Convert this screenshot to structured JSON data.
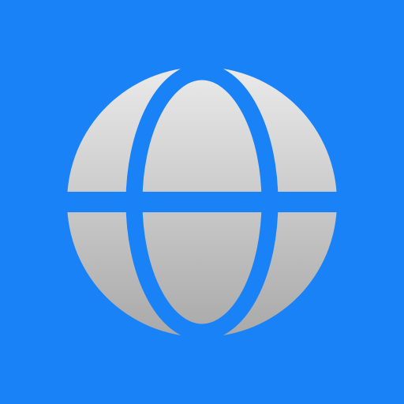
{
  "icon": {
    "name": "globe-icon",
    "background_color": "#1A82F7",
    "globe_gradient_top": "#EAEAEA",
    "globe_gradient_bottom": "#A9A9A9"
  }
}
